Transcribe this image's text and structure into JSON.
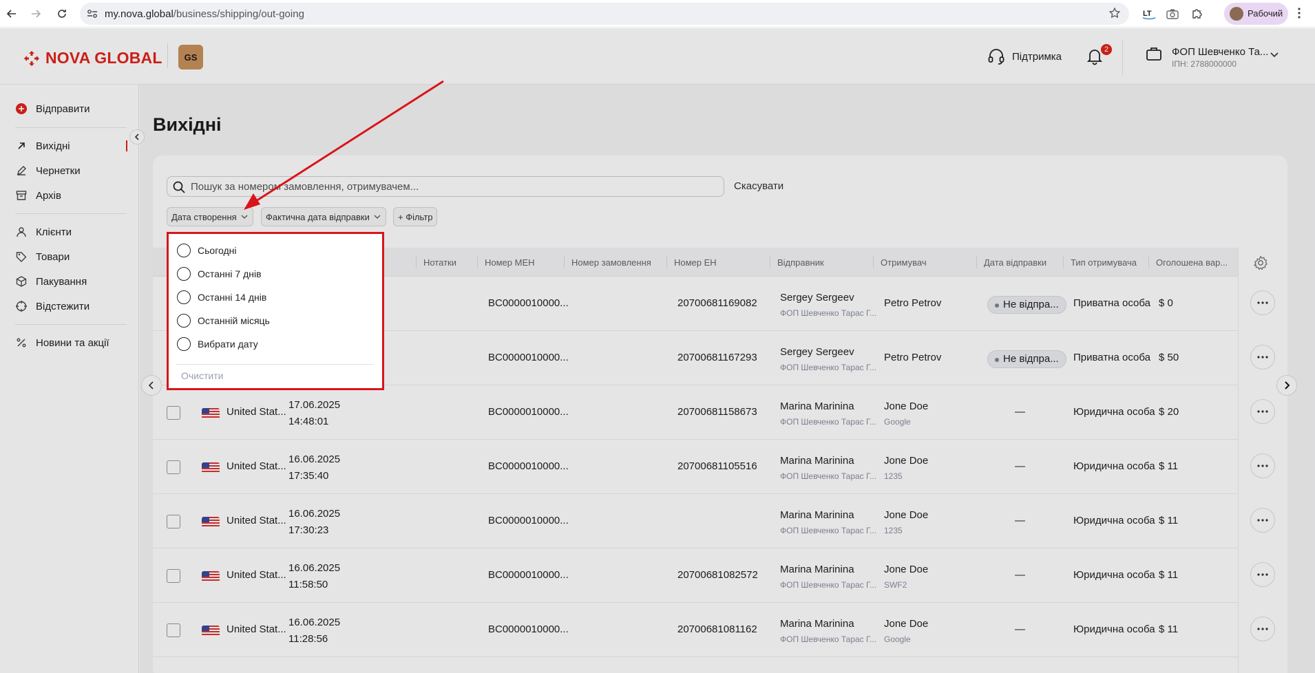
{
  "browser": {
    "url_domain": "my.nova.global",
    "url_path": "/business/shipping/out-going",
    "profile_label": "Рабочий"
  },
  "header": {
    "logo_text": "NOVA GLOBAL",
    "brand_badge": "GS",
    "support_label": "Підтримка",
    "notifications_count": "2",
    "account_name": "ФОП Шевченко Та...",
    "account_inn": "ІПН: 2788000000"
  },
  "sidebar": {
    "send_label": "Відправити",
    "items": [
      {
        "label": "Вихідні",
        "icon": "arrow-up-right-icon",
        "active": true
      },
      {
        "label": "Чернетки",
        "icon": "pencil-icon"
      },
      {
        "label": "Архів",
        "icon": "archive-icon"
      },
      {
        "label": "Клієнти",
        "icon": "users-icon"
      },
      {
        "label": "Товари",
        "icon": "tag-icon"
      },
      {
        "label": "Пакування",
        "icon": "box-icon"
      },
      {
        "label": "Відстежити",
        "icon": "target-icon"
      },
      {
        "label": "Новини та акції",
        "icon": "percent-icon"
      }
    ]
  },
  "main": {
    "title": "Вихідні",
    "search_placeholder": "Пошук за номером замовлення, отримувачем...",
    "cancel_label": "Скасувати",
    "filters": {
      "created_date": "Дата створення",
      "actual_dispatch_date": "Фактична дата відправки",
      "add_filter": "+ Фільтр"
    },
    "columns": [
      "Нотатки",
      "Номер МЕН",
      "Номер замовлення",
      "Номер ЕН",
      "Відправник",
      "Отримувач",
      "Дата відправки",
      "Тип отримувача",
      "Оголошена вар..."
    ],
    "rows": [
      {
        "country": "",
        "date": "",
        "time": "",
        "men": "BC0000010000...",
        "en": "20700681169082",
        "sender": "Sergey Sergeev",
        "sender_sub": "ФОП Шевченко Тарас Г...",
        "recipient": "Petro Petrov",
        "recipient_sub": "",
        "dispatch": "Не відпра...",
        "rtype": "Приватна особа",
        "value": "$ 0"
      },
      {
        "country": "",
        "date": "",
        "time": "",
        "men": "BC0000010000...",
        "en": "20700681167293",
        "sender": "Sergey Sergeev",
        "sender_sub": "ФОП Шевченко Тарас Г...",
        "recipient": "Petro Petrov",
        "recipient_sub": "",
        "dispatch": "Не відпра...",
        "rtype": "Приватна особа",
        "value": "$ 50"
      },
      {
        "country": "United Stat...",
        "date": "17.06.2025",
        "time": "14:48:01",
        "men": "BC0000010000...",
        "en": "20700681158673",
        "sender": "Marina Marinina",
        "sender_sub": "ФОП Шевченко Тарас Г...",
        "recipient": "Jone Doe",
        "recipient_sub": "Google",
        "dispatch": "—",
        "rtype": "Юридична особа",
        "value": "$ 20"
      },
      {
        "country": "United Stat...",
        "date": "16.06.2025",
        "time": "17:35:40",
        "men": "BC0000010000...",
        "en": "20700681105516",
        "sender": "Marina Marinina",
        "sender_sub": "ФОП Шевченко Тарас Г...",
        "recipient": "Jone Doe",
        "recipient_sub": "1235",
        "dispatch": "—",
        "rtype": "Юридична особа",
        "value": "$ 11"
      },
      {
        "country": "United Stat...",
        "date": "16.06.2025",
        "time": "17:30:23",
        "men": "BC0000010000...",
        "en": "",
        "sender": "Marina Marinina",
        "sender_sub": "ФОП Шевченко Тарас Г...",
        "recipient": "Jone Doe",
        "recipient_sub": "1235",
        "dispatch": "—",
        "rtype": "Юридична особа",
        "value": "$ 11"
      },
      {
        "country": "United Stat...",
        "date": "16.06.2025",
        "time": "11:58:50",
        "men": "BC0000010000...",
        "en": "20700681082572",
        "sender": "Marina Marinina",
        "sender_sub": "ФОП Шевченко Тарас Г...",
        "recipient": "Jone Doe",
        "recipient_sub": "SWF2",
        "dispatch": "—",
        "rtype": "Юридична особа",
        "value": "$ 11"
      },
      {
        "country": "United Stat...",
        "date": "16.06.2025",
        "time": "11:28:56",
        "men": "BC0000010000...",
        "en": "20700681081162",
        "sender": "Marina Marinina",
        "sender_sub": "ФОП Шевченко Тарас Г...",
        "recipient": "Jone Doe",
        "recipient_sub": "Google",
        "dispatch": "—",
        "rtype": "Юридична особа",
        "value": "$ 11"
      }
    ]
  },
  "date_dropdown": {
    "options": [
      "Сьогодні",
      "Останні 7 днів",
      "Останні 14 днів",
      "Останній місяць",
      "Вибрати дату"
    ],
    "clear_label": "Очистити"
  },
  "colors": {
    "brand": "#e2231a",
    "annotation": "#d9141b"
  }
}
